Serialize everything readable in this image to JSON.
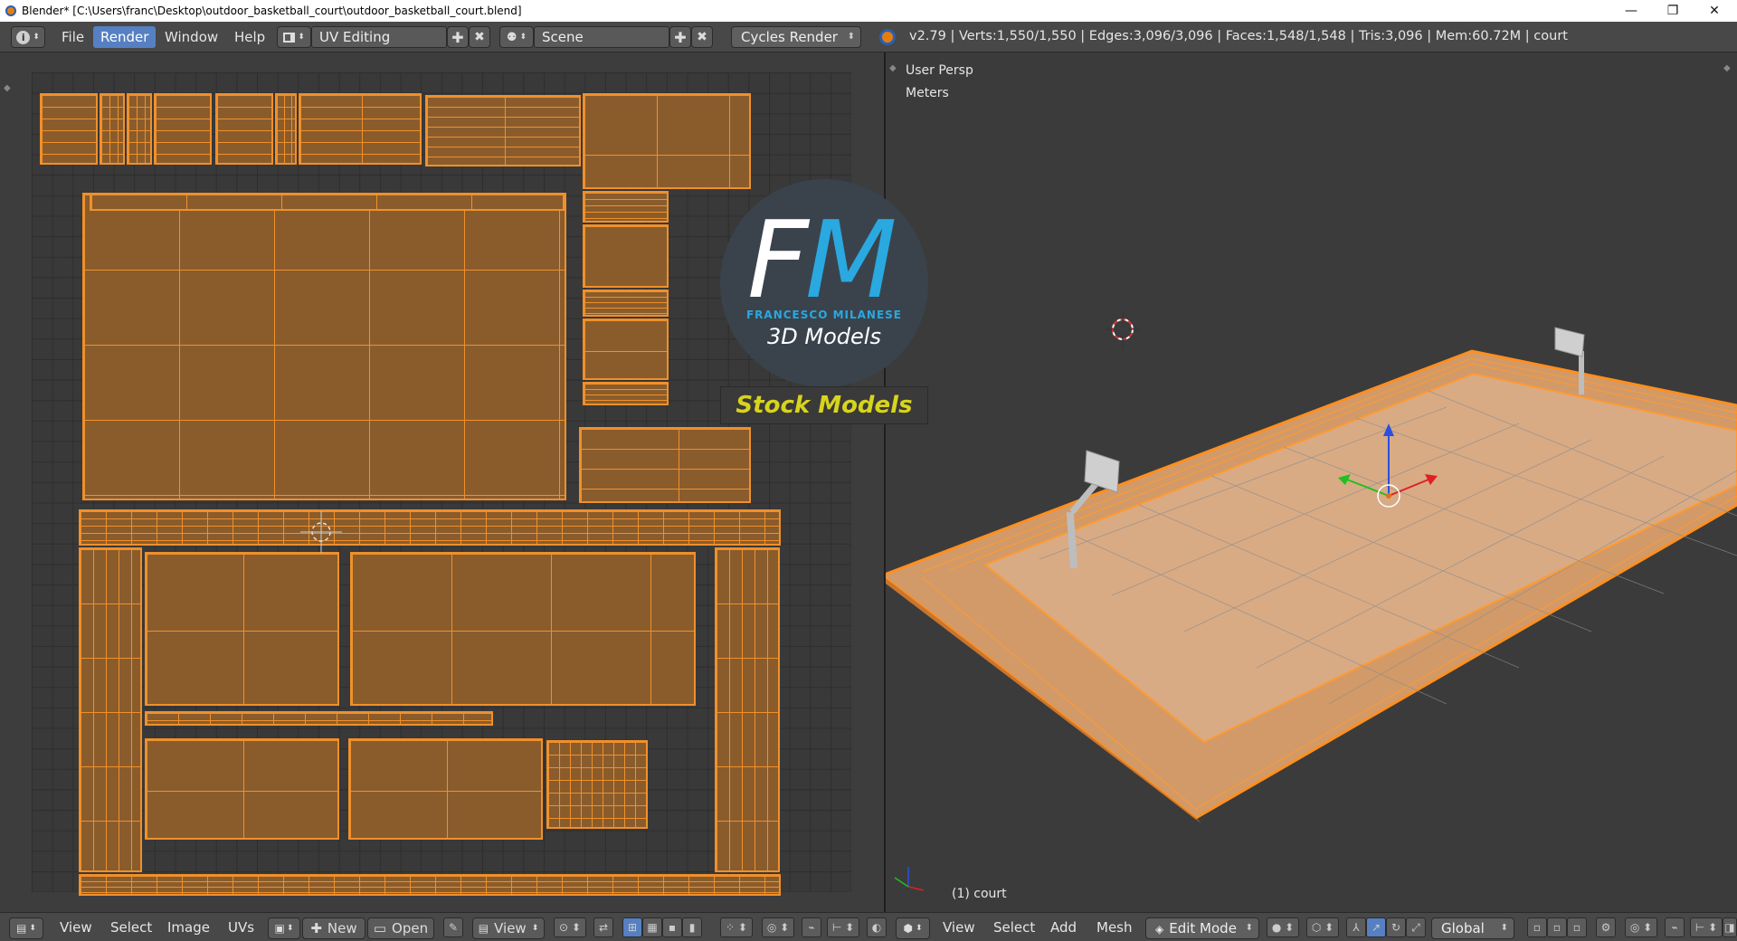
{
  "window": {
    "title": "Blender* [C:\\Users\\franc\\Desktop\\outdoor_basketball_court\\outdoor_basketball_court.blend]",
    "minimize": "—",
    "restore": "❐",
    "close": "✕"
  },
  "topbar": {
    "info_icon": "i",
    "menus": [
      "File",
      "Render",
      "Window",
      "Help"
    ],
    "active_menu": "Render",
    "screen_layout": "UV Editing",
    "scene": "Scene",
    "render_engine": "Cycles Render",
    "stats": "v2.79 | Verts:1,550/1,550 | Edges:3,096/3,096 | Faces:1,548/1,548 | Tris:3,096 | Mem:60.72M | court"
  },
  "viewport": {
    "view_name": "User Persp",
    "units": "Meters",
    "object_label": "(1) court"
  },
  "watermark": {
    "letter_f": "F",
    "letter_m": "M",
    "name": "FRANCESCO MILANESE",
    "subtitle": "3D Models",
    "banner": "Stock Models",
    "accent_color": "#2aa8e0",
    "banner_color": "#d7d41c"
  },
  "uv_footer": {
    "view": "View",
    "select": "Select",
    "image": "Image",
    "uvs": "UVs",
    "new": "New",
    "open": "Open",
    "view2": "View"
  },
  "vp_footer": {
    "view": "View",
    "select": "Select",
    "add": "Add",
    "mesh": "Mesh",
    "mode": "Edit Mode",
    "orientation": "Global"
  },
  "colors": {
    "selection_orange": "#f0902b",
    "uv_face": "#8a5c2c",
    "active_menu": "#5680c2"
  }
}
